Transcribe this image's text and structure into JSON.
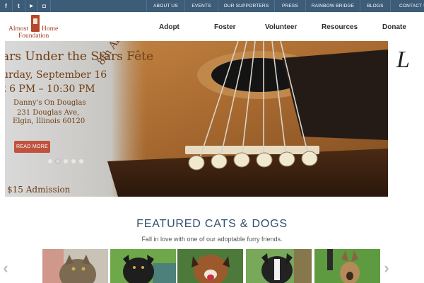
{
  "social": [
    {
      "icon": "facebook-icon",
      "glyph": "f"
    },
    {
      "icon": "twitter-icon",
      "glyph": "t"
    },
    {
      "icon": "youtube-icon",
      "glyph": "▶"
    },
    {
      "icon": "instagram-icon",
      "glyph": "◘"
    }
  ],
  "top_links": [
    "ABOUT US",
    "EVENTS",
    "OUR SUPPORTERS",
    "PRESS",
    "RAINBOW BRIDGE",
    "BLOGS",
    "CONTACT US"
  ],
  "logo": {
    "line1a": "Almost",
    "line1b": "Home",
    "line2": "Foundation"
  },
  "main_nav": [
    "Adopt",
    "Foster",
    "Volunteer",
    "Resources",
    "Donate"
  ],
  "hero": {
    "title": "ars Under the Stars Fête",
    "date": "urday, September 16",
    "time": "t 6 PM – 10:30 PM",
    "annual": "8th Annual",
    "venue": "Danny's On Douglas",
    "address1": "231 Douglas Ave,",
    "address2": "Elgin, Illinois 60120",
    "readmore": "READ MORE",
    "admission": "$15 Admission",
    "right_glyph": "L",
    "slide_count": 5,
    "active_slide": 1
  },
  "featured": {
    "title": "FEATURED CATS & DOGS",
    "subtitle": "Fall in love with one of our adoptable furry friends.",
    "prev": "‹",
    "next": "›"
  },
  "colors": {
    "topbar": "#3c5c78",
    "brand": "#a23a22",
    "button": "#c0533e",
    "heading": "#2f4f6b"
  }
}
